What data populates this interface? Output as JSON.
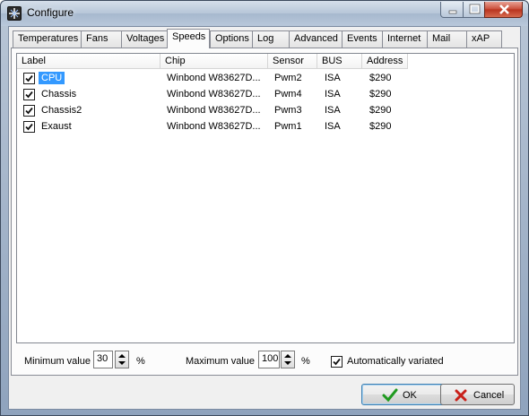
{
  "window": {
    "title": "Configure",
    "icon": "config-app-icon",
    "controls": [
      "minimize-icon",
      "maximize-icon",
      "close-icon"
    ]
  },
  "tabs": [
    {
      "label": "Temperatures",
      "active": false
    },
    {
      "label": "Fans",
      "active": false
    },
    {
      "label": "Voltages",
      "active": false
    },
    {
      "label": "Speeds",
      "active": true
    },
    {
      "label": "Options",
      "active": false
    },
    {
      "label": "Log",
      "active": false
    },
    {
      "label": "Advanced",
      "active": false
    },
    {
      "label": "Events",
      "active": false
    },
    {
      "label": "Internet",
      "active": false
    },
    {
      "label": "Mail",
      "active": false
    },
    {
      "label": "xAP",
      "active": false
    }
  ],
  "table": {
    "columns": [
      "Label",
      "Chip",
      "Sensor",
      "BUS",
      "Address"
    ],
    "rows": [
      {
        "checked": true,
        "label": "CPU",
        "chip": "Winbond W83627D...",
        "sensor": "Pwm2",
        "bus": "ISA",
        "address": "$290",
        "selected": true
      },
      {
        "checked": true,
        "label": "Chassis",
        "chip": "Winbond W83627D...",
        "sensor": "Pwm4",
        "bus": "ISA",
        "address": "$290",
        "selected": false
      },
      {
        "checked": true,
        "label": "Chassis2",
        "chip": "Winbond W83627D...",
        "sensor": "Pwm3",
        "bus": "ISA",
        "address": "$290",
        "selected": false
      },
      {
        "checked": true,
        "label": "Exaust",
        "chip": "Winbond W83627D...",
        "sensor": "Pwm1",
        "bus": "ISA",
        "address": "$290",
        "selected": false
      }
    ]
  },
  "min_value": {
    "label": "Minimum value",
    "value": "30",
    "unit": "%"
  },
  "max_value": {
    "label": "Maximum value",
    "value": "100",
    "unit": "%"
  },
  "auto_variated": {
    "label": "Automatically variated",
    "checked": true
  },
  "buttons": {
    "ok": {
      "label": "OK",
      "icon": "check-icon"
    },
    "cancel": {
      "label": "Cancel",
      "icon": "x-icon"
    }
  },
  "colors": {
    "selection": "#3399ff",
    "ok_icon": "#1f9a1f",
    "cancel_icon": "#c8201a"
  }
}
